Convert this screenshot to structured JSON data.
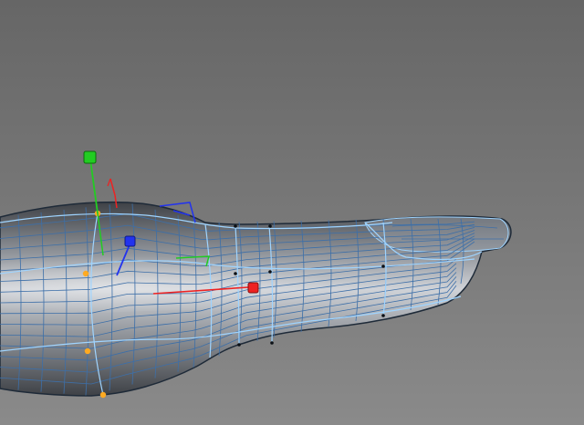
{
  "viewport": {
    "name": "3d-viewport",
    "background_top": "#666666",
    "background_bottom": "#8a8a8a"
  },
  "mesh": {
    "name": "finger-mesh",
    "wire_color": "#3d6fa8",
    "edge_loop_color": "#9fd4ff",
    "surface_light": "#d0d3d8",
    "surface_mid": "#8c9096",
    "surface_dark": "#3e4146"
  },
  "gizmo": {
    "name": "move-rotate-gizmo",
    "x_axis_color": "#ee2222",
    "y_axis_color": "#22cc22",
    "z_axis_color": "#2233ee",
    "x_handle_icon": "red-square-handle-icon",
    "y_handle_icon": "green-square-handle-icon",
    "z_handle_icon": "blue-square-handle-icon"
  },
  "selected_points": {
    "name": "selected-vertices",
    "color": "#ffaa22"
  }
}
